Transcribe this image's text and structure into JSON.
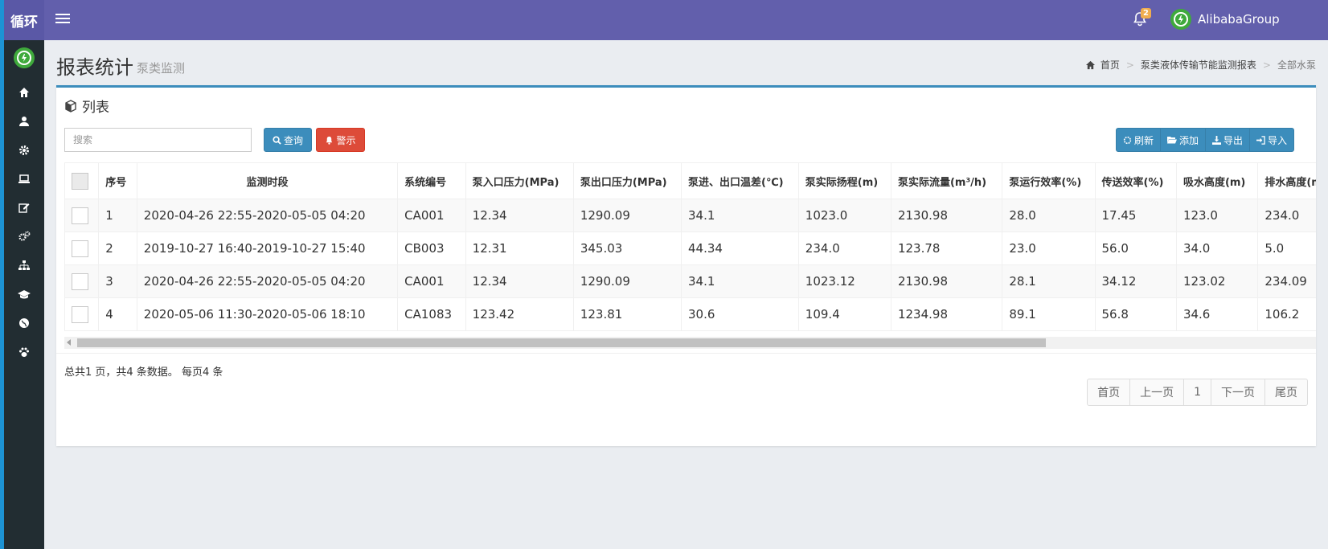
{
  "app": {
    "brand": "循环",
    "user_name": "AlibabaGroup",
    "notification_count": "2"
  },
  "colors": {
    "topbar": "#625fac",
    "sidebar": "#222d32",
    "primary": "#3c8dbc",
    "danger": "#dd4b39",
    "accent_green": "#3faa3c"
  },
  "sidebar": {
    "icons": [
      "logo-icon",
      "home-icon",
      "user-icon",
      "gear-icon",
      "laptop-icon",
      "edit-icon",
      "cogs-icon",
      "sitemap-icon",
      "graduation-cap-icon",
      "globe-icon",
      "paw-icon"
    ]
  },
  "header": {
    "title": "报表统计",
    "subtitle": "泵类监测"
  },
  "breadcrumb": {
    "home": "首页",
    "level2": "泵类液体传输节能监测报表",
    "current": "全部水泵"
  },
  "box": {
    "title": "列表"
  },
  "search": {
    "placeholder": "搜索"
  },
  "buttons": {
    "query": "查询",
    "alarm": "警示",
    "refresh": "刷新",
    "add": "添加",
    "export": "导出",
    "import": "导入"
  },
  "table": {
    "headers": [
      "序号",
      "监测时段",
      "系统编号",
      "泵入口压力(MPa)",
      "泵出口压力(MPa)",
      "泵进、出口温差(℃)",
      "泵实际扬程(m)",
      "泵实际流量(m³/h)",
      "泵运行效率(%)",
      "传送效率(%)",
      "吸水高度(m)",
      "排水高度(m)"
    ],
    "rows": [
      [
        "1",
        "2020-04-26 22:55-2020-05-05 04:20",
        "CA001",
        "12.34",
        "1290.09",
        "34.1",
        "1023.0",
        "2130.98",
        "28.0",
        "17.45",
        "123.0",
        "234.0"
      ],
      [
        "2",
        "2019-10-27 16:40-2019-10-27 15:40",
        "CB003",
        "12.31",
        "345.03",
        "44.34",
        "234.0",
        "123.78",
        "23.0",
        "56.0",
        "34.0",
        "5.0"
      ],
      [
        "3",
        "2020-04-26 22:55-2020-05-05 04:20",
        "CA001",
        "12.34",
        "1290.09",
        "34.1",
        "1023.12",
        "2130.98",
        "28.1",
        "34.12",
        "123.02",
        "234.09"
      ],
      [
        "4",
        "2020-05-06 11:30-2020-05-06 18:10",
        "CA1083",
        "123.42",
        "123.81",
        "30.6",
        "109.4",
        "1234.98",
        "89.1",
        "56.8",
        "34.6",
        "106.2"
      ]
    ]
  },
  "pagination": {
    "summary": "总共1 页，共4 条数据。 每页4 条",
    "first": "首页",
    "prev": "上一页",
    "page": "1",
    "next": "下一页",
    "last": "尾页"
  }
}
